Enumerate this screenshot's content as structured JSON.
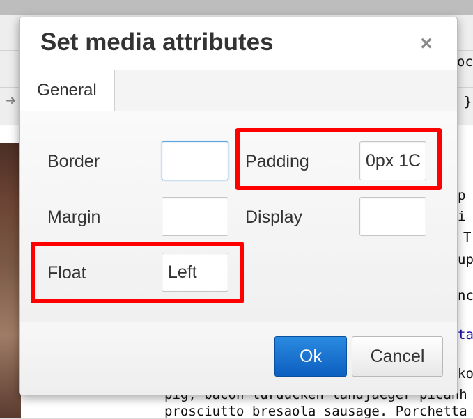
{
  "dialog": {
    "title": "Set media attributes",
    "close_symbol": "×",
    "tabs": [
      {
        "label": "General"
      }
    ],
    "fields": {
      "border": {
        "label": "Border",
        "value": ""
      },
      "padding": {
        "label": "Padding",
        "value": "0px 1C"
      },
      "margin": {
        "label": "Margin",
        "value": ""
      },
      "display": {
        "label": "Display",
        "value": ""
      },
      "float": {
        "label": "Float",
        "value": "Left"
      }
    },
    "buttons": {
      "ok": "Ok",
      "cancel": "Cancel"
    }
  },
  "background": {
    "header_fragment": "oc",
    "toolbar_fragment": "}",
    "text_fragments": [
      "p",
      "i a",
      "T",
      "up",
      "nc",
      "ta",
      "ko",
      "pig, bacon turducken landjaeger picanh",
      "prosciutto bresaola sausage. Porchetta"
    ]
  },
  "colors": {
    "highlight": "#ff0000",
    "ok_button": "#1a73d1",
    "focus_border": "#59a5e5"
  },
  "icons": {
    "close": "close-icon",
    "arrow": "arrow-right-icon"
  }
}
